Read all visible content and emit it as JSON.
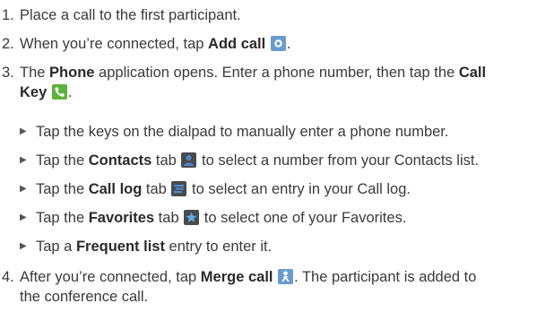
{
  "steps": [
    {
      "num": "1.",
      "text": "Place a call to the first participant."
    },
    {
      "num": "2.",
      "pre": "When you’re connected, tap ",
      "key": "Add call",
      "post": " ",
      "end": "."
    },
    {
      "num": "3.",
      "pre": "The ",
      "key1": "Phone",
      "mid": " application opens. Enter a phone number, then tap the ",
      "key2": "Call",
      "line2_key": "Key",
      "end": "."
    },
    {
      "num": "4.",
      "pre": "After you’re connected, tap ",
      "key": "Merge call",
      "post": ". The participant is added to",
      "line2": "the conference call."
    }
  ],
  "bullets": [
    {
      "text": "Tap the keys on the dialpad to manually enter a phone number."
    },
    {
      "pre": "Tap the ",
      "key": "Contacts",
      "mid": " tab ",
      "post": " to select a number from your Contacts list."
    },
    {
      "pre": "Tap the ",
      "key": "Call log",
      "mid": " tab ",
      "post": " to select an entry in your Call log."
    },
    {
      "pre": "Tap the ",
      "key": "Favorites",
      "mid": " tab ",
      "post": " to select one of your Favorites."
    },
    {
      "pre": "Tap a ",
      "key": "Frequent list",
      "post": " entry to enter it."
    }
  ],
  "icons": {
    "add_call": "add-call-icon",
    "call_key": "call-key-icon",
    "contacts": "contacts-tab-icon",
    "call_log": "call-log-tab-icon",
    "favorites": "favorites-tab-icon",
    "merge_call": "merge-call-icon"
  },
  "colors": {
    "text": "#3a3a3a",
    "icon_blue": "#5b8fc7",
    "call_green": "#5bb33a"
  }
}
